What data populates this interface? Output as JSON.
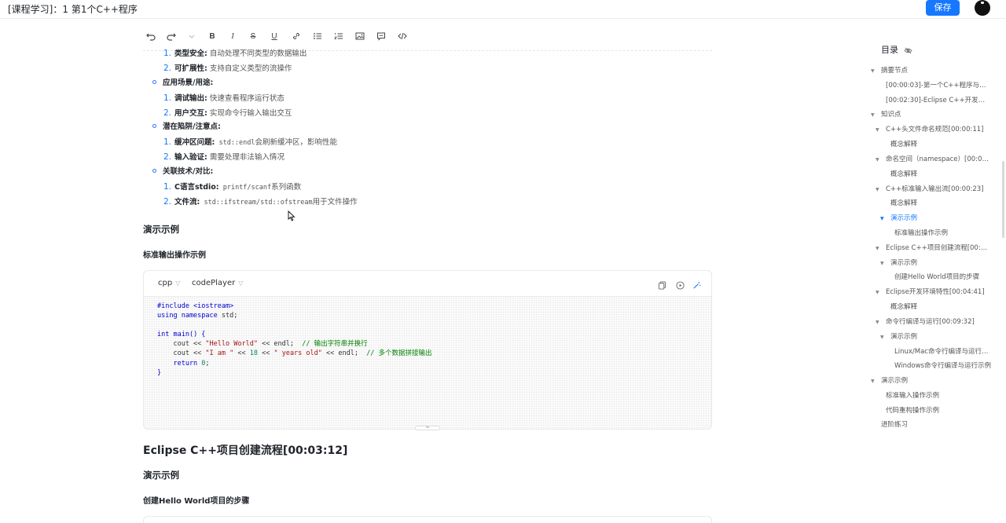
{
  "header": {
    "title": "[课程学习]：1 第1个C++程序",
    "save_label": "保存"
  },
  "toolbar": {
    "tools": [
      "undo-icon",
      "redo-icon",
      "more-icon",
      "bold-icon",
      "italic-icon",
      "strikethrough-icon",
      "underline-icon",
      "link-icon",
      "bullet-list-icon",
      "ordered-list-icon",
      "image-icon",
      "comment-icon",
      "code-icon"
    ]
  },
  "content": {
    "list1": [
      {
        "num": "1.",
        "label": "类型安全:",
        "text": " 自动处理不同类型的数据输出"
      },
      {
        "num": "2.",
        "label": "可扩展性:",
        "text": " 支持自定义类型的流操作"
      }
    ],
    "bullet_scenario": "应用场景/用途:",
    "list2": [
      {
        "num": "1.",
        "label": "调试输出:",
        "text": " 快速查看程序运行状态"
      },
      {
        "num": "2.",
        "label": "用户交互:",
        "text": " 实现命令行输入输出交互"
      }
    ],
    "bullet_pitfall": "潜在陷阱/注意点:",
    "list3_1": {
      "num": "1.",
      "label": "缓冲区问题:",
      "code": " std::endl",
      "text": "会刷新缓冲区，影响性能"
    },
    "list3_2": {
      "num": "2.",
      "label": "输入验证:",
      "text": " 需要处理非法输入情况"
    },
    "bullet_related": "关联技术/对比:",
    "list4_1": {
      "num": "1.",
      "label": "C语言stdio:",
      "code": " printf/scanf",
      "text": "系列函数"
    },
    "list4_2": {
      "num": "2.",
      "label": "文件流:",
      "code": " std::ifstream/std::ofstream",
      "text": "用于文件操作"
    },
    "demo_heading": "演示示例",
    "demo_sub": "标准输出操作示例",
    "eclipse_heading": "Eclipse C++项目创建流程[00:03:12]",
    "eclipse_demo": "演示示例",
    "eclipse_sub": "创建Hello World项目的步骤"
  },
  "codeblock": {
    "language": "cpp",
    "player": "codePlayer",
    "lines": {
      "l1": "#include <iostream>",
      "l2a": "using namespace",
      "l2b": " std;",
      "l4a": "int",
      "l4b": " main() {",
      "l5a": "    cout << ",
      "l5b": "\"Hello World\"",
      "l5c": " << endl;  ",
      "l5d": "// 输出字符串并换行",
      "l6a": "    cout << ",
      "l6b": "\"I am \"",
      "l6c": " << ",
      "l6d": "18",
      "l6e": " << ",
      "l6f": "\" years old\"",
      "l6g": " << endl;  ",
      "l6h": "// 多个数据拼接输出",
      "l7a": "    return ",
      "l7b": "0",
      "l7c": ";",
      "l8": "}"
    }
  },
  "toc": {
    "title": "目录",
    "items": [
      {
        "text": "摘要节点"
      },
      {
        "text": "[00:00:03]-第一个C++程序与基…"
      },
      {
        "text": "[00:02:30]-Eclipse C++开发环境…"
      },
      {
        "text": "知识点"
      },
      {
        "text": "C++头文件命名规范[00:00:11]"
      },
      {
        "text": "概念解释"
      },
      {
        "text": "命名空间（namespace）[00:00:…"
      },
      {
        "text": "概念解释"
      },
      {
        "text": "C++标准输入输出流[00:00:23]"
      },
      {
        "text": "概念解释"
      },
      {
        "text": "演示示例"
      },
      {
        "text": "标准输出操作示例"
      },
      {
        "text": "Eclipse C++项目创建流程[00:03:…"
      },
      {
        "text": "演示示例"
      },
      {
        "text": "创建Hello World项目的步骤"
      },
      {
        "text": "Eclipse开发环境特性[00:04:41]"
      },
      {
        "text": "概念解释"
      },
      {
        "text": "命令行编译与运行[00:09:32]"
      },
      {
        "text": "演示示例"
      },
      {
        "text": "Linux/Mac命令行编译与运行…"
      },
      {
        "text": "Windows命令行编译与运行示例"
      },
      {
        "text": "演示示例"
      },
      {
        "text": "标准输入操作示例"
      },
      {
        "text": "代码重构操作示例"
      },
      {
        "text": "进阶练习"
      }
    ]
  },
  "colors": {
    "accent": "#1677ff",
    "toc_active": "#1677ff"
  }
}
